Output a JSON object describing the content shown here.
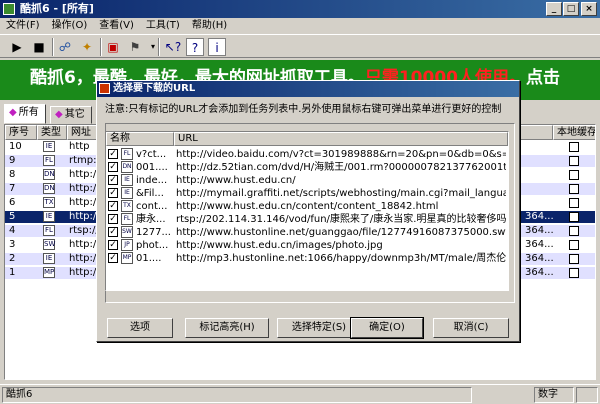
{
  "window": {
    "title": "酷抓6 - [所有]",
    "min": "_",
    "max": "□",
    "close": "×"
  },
  "menu": [
    "文件(F)",
    "操作(O)",
    "查看(V)",
    "工具(T)",
    "帮助(H)"
  ],
  "banner": {
    "text": "酷抓6，最酷，最好，最大的网址抓取工具。",
    "red": "只需10000人使用。",
    "tail": "点击"
  },
  "tabs": [
    "所有",
    "其它"
  ],
  "list": {
    "headers": [
      "序号",
      "类型",
      "网址",
      "本地缓存"
    ],
    "rows": [
      {
        "num": "10",
        "type": "IE",
        "url": "http",
        "extra": "",
        "style": ""
      },
      {
        "num": "9",
        "type": "FL",
        "url": "rtmp://",
        "extra": "",
        "style": "alt"
      },
      {
        "num": "8",
        "type": "DN",
        "url": "http://",
        "extra": "",
        "style": ""
      },
      {
        "num": "7",
        "type": "DN",
        "url": "http://",
        "extra": "",
        "style": "alt"
      },
      {
        "num": "6",
        "type": "TX",
        "url": "http://",
        "extra": "",
        "style": ""
      },
      {
        "num": "5",
        "type": "IE",
        "url": "http://",
        "extra": "364...",
        "style": "sel"
      },
      {
        "num": "4",
        "type": "FL",
        "url": "rtsp://2",
        "extra": "364...",
        "style": "alt"
      },
      {
        "num": "3",
        "type": "SW",
        "url": "http://",
        "extra": "364...",
        "style": ""
      },
      {
        "num": "2",
        "type": "IE",
        "url": "http://",
        "extra": "364...",
        "style": "alt"
      },
      {
        "num": "1",
        "type": "MP",
        "url": "http://",
        "extra": "364...",
        "style": "alt"
      }
    ]
  },
  "status": {
    "left": "酷抓6",
    "mid": "数字"
  },
  "dialog": {
    "title": "选择要下载的URL",
    "note": "注意:只有标记的URL才会添加到任务列表中.另外使用鼠标右键可弹出菜单进行更好的控制",
    "headers": [
      "名称",
      "URL"
    ],
    "rows": [
      {
        "icon": "FL",
        "name": "v?ct...",
        "url": "http://video.baidu.com/v?ct=301989888&rn=20&pn=0&db=0&s=0&fbl=1024&word="
      },
      {
        "icon": "DN",
        "name": "001....",
        "url": "http://dz.52tian.com/dvd/H/海贼王/001.rm?000000782137762001tflag=1208"
      },
      {
        "icon": "IE",
        "name": "inde...",
        "url": "http://www.hust.edu.cn/"
      },
      {
        "icon": "IE",
        "name": "&Fil...",
        "url": "http://mymail.graffiti.net/scripts/webhosting/main.cgi?mail_language=u"
      },
      {
        "icon": "TX",
        "name": "cont...",
        "url": "http://www.hust.edu.cn/content/content_18842.html"
      },
      {
        "icon": "FL",
        "name": "康永...",
        "url": "rtsp://202.114.31.146/vod/fun/康熙来了/康永当家.明星真的比较奢侈吗.Rmvb"
      },
      {
        "icon": "SW",
        "name": "1277...",
        "url": "http://www.hustonline.net/guanggao/file/12774916087375000.swf"
      },
      {
        "icon": "JP",
        "name": "phot...",
        "url": "http://www.hust.edu.cn/images/photo.jpg"
      },
      {
        "icon": "MP",
        "name": "01....",
        "url": "http://mp3.hustonline.net:1066/happy/downmp3h/MT/male/周杰伦/11月的萧邦"
      }
    ],
    "check": "✓",
    "buttons": [
      "选项",
      "标记高亮(H)",
      "选择特定(S)",
      "确定(O)",
      "取消(C)"
    ]
  },
  "colors": {
    "titlebar": "#0a246a",
    "banner": "#1a8a1a",
    "selection": "#0a246a",
    "alt_row": "#e0e0ff"
  }
}
